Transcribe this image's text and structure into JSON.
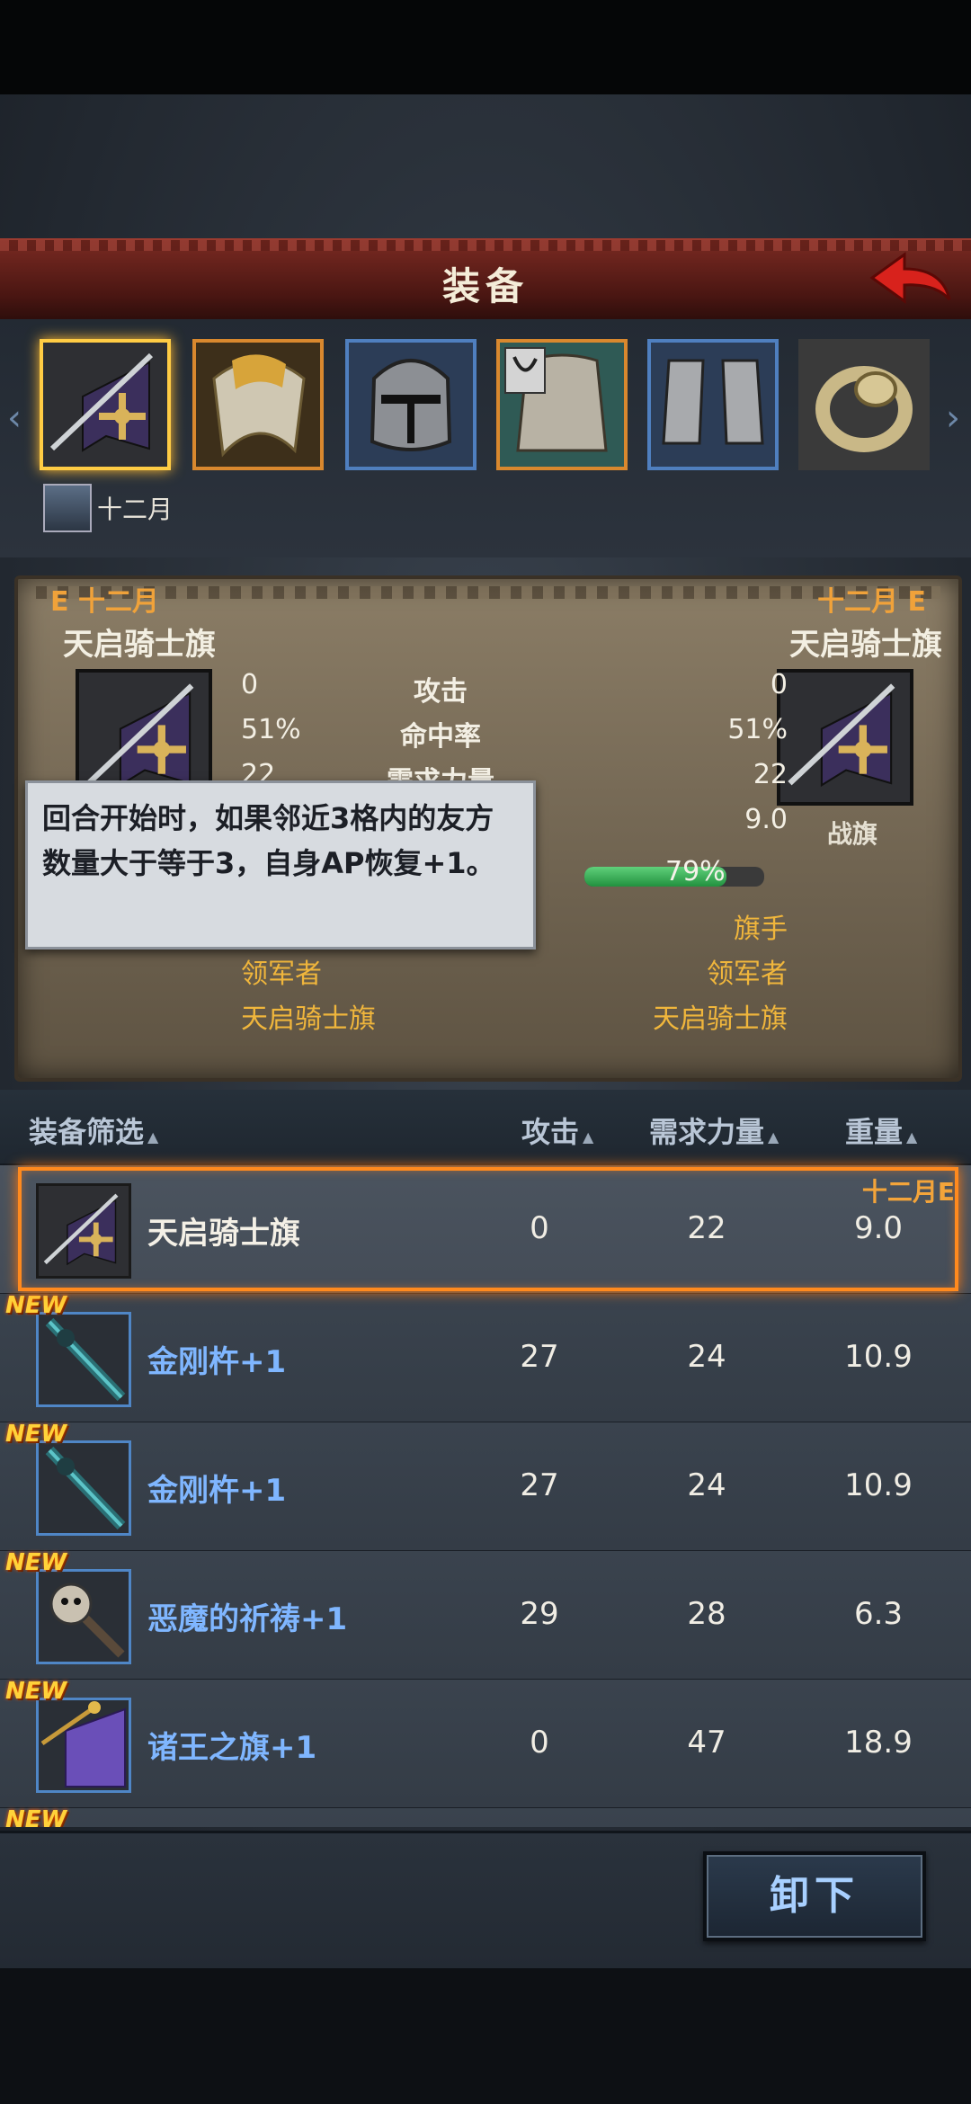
{
  "header": {
    "title": "装备"
  },
  "slots": {
    "icons": [
      "banner-icon",
      "armor-pauldron-icon",
      "helmet-icon",
      "plate-armor-icon",
      "greaves-icon",
      "ring-icon"
    ],
    "character_name": "十二月"
  },
  "compare": {
    "left_owner": "E 十二月",
    "right_owner": "十二月 E",
    "left_item_name": "天启骑士旗",
    "right_item_name": "天启骑士旗",
    "right_item_type": "战旗",
    "stats": [
      {
        "name": "攻击",
        "left": "0",
        "right": "0"
      },
      {
        "name": "命中率",
        "left": "51%",
        "right": "51%"
      },
      {
        "name": "需求力量",
        "left": "22",
        "right": "22"
      },
      {
        "name": "",
        "left": "",
        "right": "9.0"
      }
    ],
    "durability_percent": 79,
    "durability_text": "79%",
    "right_class": "旗手",
    "left_role": "领军者",
    "right_role": "领军者",
    "left_set": "天启骑士旗",
    "right_set": "天启骑士旗"
  },
  "tooltip": {
    "text": "回合开始时，如果邻近3格内的友方数量大于等于3，自身AP恢复+1。"
  },
  "list_header": {
    "filter": "装备筛选",
    "attack": "攻击",
    "strength": "需求力量",
    "weight": "重量"
  },
  "items": [
    {
      "name": "天启骑士旗",
      "attack": "0",
      "strength": "22",
      "weight": "9.0",
      "new": "",
      "equipped_by": "十二月E",
      "icon": "banner-icon"
    },
    {
      "name": "金刚杵+1",
      "attack": "27",
      "strength": "24",
      "weight": "10.9",
      "new": "NEW",
      "icon": "mace-icon"
    },
    {
      "name": "金刚杵+1",
      "attack": "27",
      "strength": "24",
      "weight": "10.9",
      "new": "NEW",
      "icon": "mace-icon"
    },
    {
      "name": "恶魔的祈祷+1",
      "attack": "29",
      "strength": "28",
      "weight": "6.3",
      "new": "NEW",
      "icon": "demon-skull-mace-icon"
    },
    {
      "name": "诸王之旗+1",
      "attack": "0",
      "strength": "47",
      "weight": "18.9",
      "new": "NEW",
      "icon": "purple-banner-icon"
    },
    {
      "name": "",
      "attack": "",
      "strength": "",
      "weight": "",
      "new": "NEW",
      "icon": ""
    }
  ],
  "actions": {
    "unequip": "卸下"
  },
  "colors": {
    "selected_border": "#ff8a1e",
    "new_badge": "#ffd23a",
    "item_name_blue": "#7fb6ff",
    "owner_label": "#f0a23a"
  }
}
